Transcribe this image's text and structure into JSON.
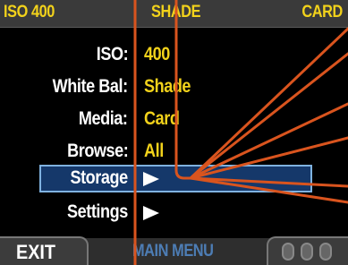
{
  "status_bar": {
    "iso": "ISO 400",
    "white_balance": "SHADE",
    "media": "CARD"
  },
  "menu": {
    "items": [
      {
        "label": "ISO:",
        "value": "400"
      },
      {
        "label": "White Bal:",
        "value": "Shade"
      },
      {
        "label": "Media:",
        "value": "Card"
      },
      {
        "label": "Browse:",
        "value": "All"
      },
      {
        "label": "Storage",
        "value": ""
      },
      {
        "label": "Settings",
        "value": ""
      }
    ],
    "selected_index": 4
  },
  "footer": {
    "exit_label": "EXIT",
    "title": "MAIN MENU",
    "dial_icon": "scroll-wheel-icon"
  },
  "colors": {
    "accent_yellow": "#f2d21b",
    "highlight_fill": "#15386a",
    "highlight_border": "#7fb2e0",
    "callout_line": "#d9541e"
  }
}
